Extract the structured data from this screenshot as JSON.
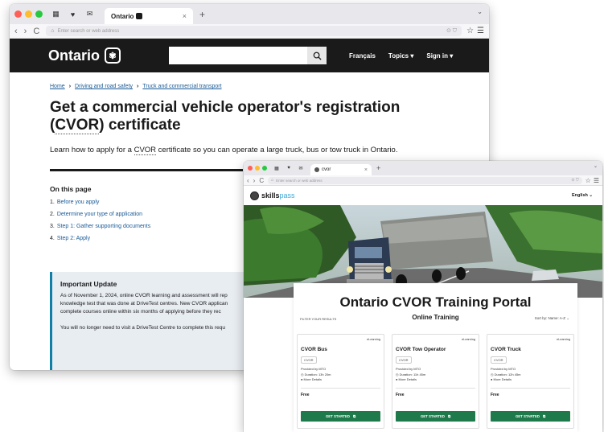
{
  "win1": {
    "tab_title": "Ontario",
    "url_placeholder": "Enter search or web address",
    "header": {
      "logo": "Ontario",
      "nav": [
        "Français",
        "Topics ▾",
        "Sign in ▾"
      ]
    },
    "breadcrumb": [
      "Home",
      "Driving and road safety",
      "Truck and commercial transport"
    ],
    "title_pre": "Get a commercial vehicle operator's registration (",
    "title_abbr": "CVOR",
    "title_post": ") certificate",
    "lead_pre": "Learn how to apply for a ",
    "lead_abbr": "CVOR",
    "lead_post": " certificate so you can operate a large truck, bus or tow truck in Ontario.",
    "on_this_page": {
      "heading": "On this page",
      "items": [
        {
          "num": "1.",
          "label": "Before you apply"
        },
        {
          "num": "2.",
          "label": "Determine your type of application"
        },
        {
          "num": "3.",
          "label": "Step 1: Gather supporting documents"
        },
        {
          "num": "4.",
          "label": "Step 2: Apply"
        }
      ]
    },
    "callout": {
      "heading": "Important Update",
      "lines": [
        "As of November 1, 2024, online CVOR learning and assessment will rep",
        "knowledge test that was done at DriveTest centres. New CVOR applican",
        "complete courses online within six months of applying before they rec",
        "",
        "You will no longer need to visit a DriveTest Centre to complete this requ"
      ]
    }
  },
  "win2": {
    "tab_title": "cvor",
    "url_placeholder": "Enter search or web address",
    "logo_skills": "skills",
    "logo_pass": "pass",
    "language": "English ⌄",
    "portal_title": "Ontario CVOR Training Portal",
    "filter_label": "FILTER YOUR RESULTS",
    "online_training": "Online Training",
    "sort_by": "Sort by:  Name: A-Z ⌄",
    "cards": [
      {
        "type": "eLearning",
        "title": "CVOR Bus",
        "tag": "CVOR",
        "provider": "Provided by MTO",
        "duration": "Duration: 13h 20m",
        "details": "More Details",
        "price": "Free",
        "cta": "GET STARTED"
      },
      {
        "type": "eLearning",
        "title": "CVOR Tow Operator",
        "tag": "CVOR",
        "provider": "Provided by MTO",
        "duration": "Duration: 11h 45m",
        "details": "More Details",
        "price": "Free",
        "cta": "GET STARTED"
      },
      {
        "type": "eLearning",
        "title": "CVOR Truck",
        "tag": "CVOR",
        "provider": "Provided by MTO",
        "duration": "Duration: 12h 45m",
        "details": "More Details",
        "price": "Free",
        "cta": "GET STARTED"
      }
    ]
  }
}
